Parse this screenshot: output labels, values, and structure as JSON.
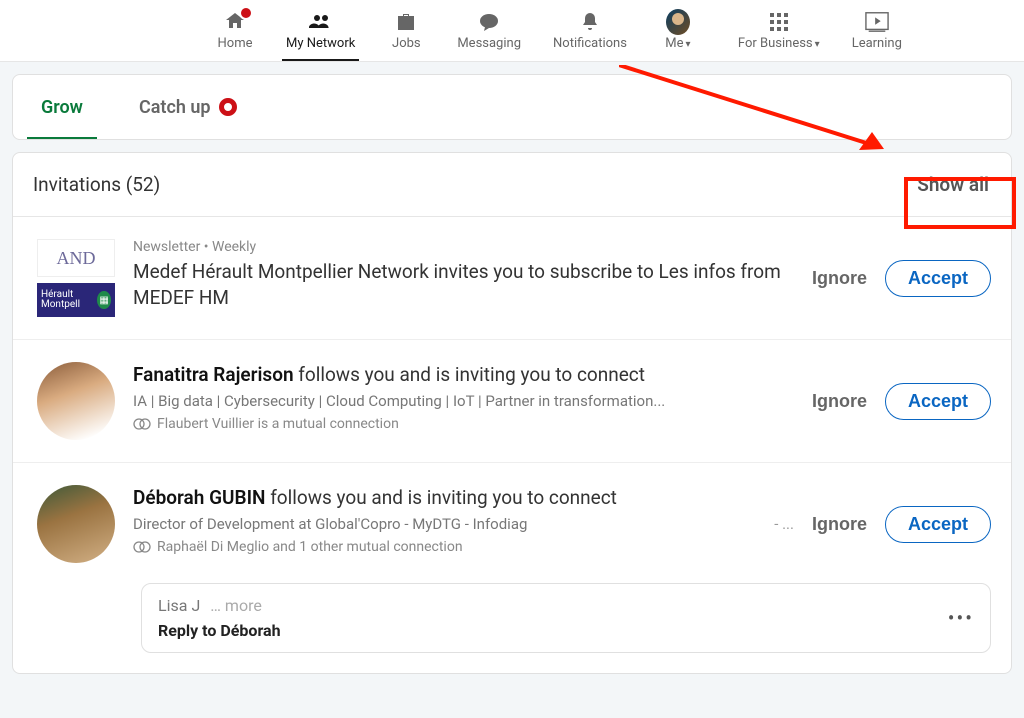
{
  "nav": {
    "home": "Home",
    "network": "My Network",
    "jobs": "Jobs",
    "messaging": "Messaging",
    "notifications": "Notifications",
    "me": "Me",
    "business": "For Business",
    "learning": "Learning"
  },
  "tabs": {
    "grow": "Grow",
    "catch_up": "Catch up"
  },
  "invitations": {
    "title": "Invitations (52)",
    "show_all": "Show all"
  },
  "items": [
    {
      "meta": "Newsletter • Weekly",
      "thumb_top": "AND",
      "thumb_bot": "Hérault Montpell",
      "line": "Medef Hérault Montpellier Network invites you to subscribe to Les infos from MEDEF HM",
      "ignore": "Ignore",
      "accept": "Accept"
    },
    {
      "name": "Fanatitra Rajerison",
      "line_suffix": " follows you and is inviting you to connect",
      "sub": "IA | Big data | Cybersecurity |  Cloud Computing | IoT | Partner in transformation...",
      "mutual": "Flaubert Vuillier is a mutual connection",
      "ignore": "Ignore",
      "accept": "Accept"
    },
    {
      "name": "Déborah GUBIN",
      "line_suffix": " follows you and is inviting you to connect",
      "sub": "Director of Development at Global'Copro - MyDTG - Infodiag",
      "sub_tail": "- ...",
      "mutual": "Raphaël Di Meglio and 1 other mutual connection",
      "ignore": "Ignore",
      "accept": "Accept",
      "msg_preview": "Lisa J",
      "msg_more": "… more",
      "msg_reply": "Reply to Déborah"
    }
  ]
}
